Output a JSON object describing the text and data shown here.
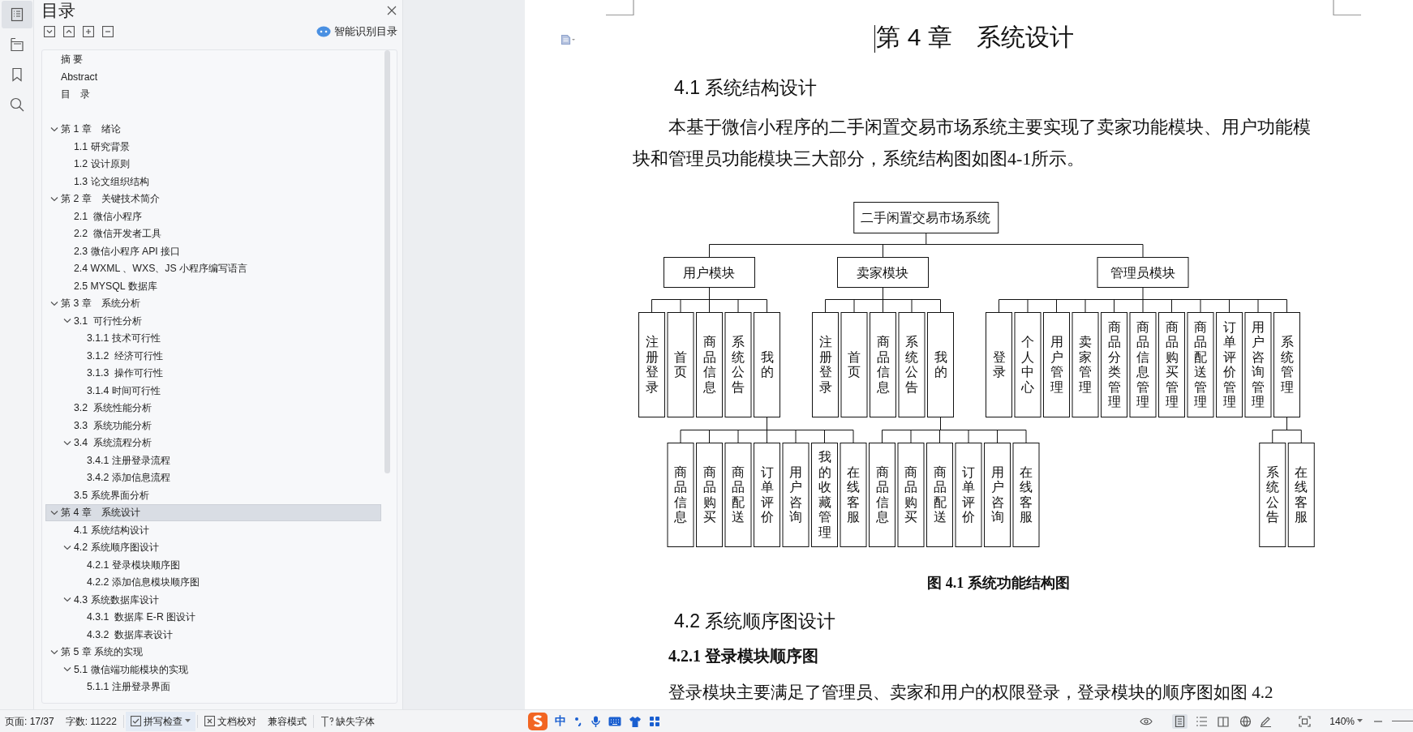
{
  "sidebar_rail": [
    {
      "kind": "contents",
      "selected": true
    },
    {
      "kind": "outline",
      "selected": false
    },
    {
      "kind": "bookmark",
      "selected": false
    },
    {
      "kind": "search",
      "selected": false
    }
  ],
  "toc_panel": {
    "title": "目录",
    "tools": [
      {
        "kind": "collapse"
      },
      {
        "kind": "expand"
      },
      {
        "kind": "promote"
      },
      {
        "kind": "demote"
      }
    ],
    "smart_button": "智能识别目录",
    "front_matter": [
      {
        "label": "摘 要"
      },
      {
        "label": "Abstract"
      },
      {
        "label": "目　录"
      }
    ],
    "chapters": [
      {
        "label": "第 1 章　绪论",
        "expanded": true,
        "selected": false,
        "children": [
          {
            "label": "1.1 研究背景"
          },
          {
            "label": "1.2 设计原则"
          },
          {
            "label": "1.3 论文组织结构"
          }
        ]
      },
      {
        "label": "第 2 章　关键技术简介",
        "expanded": true,
        "selected": false,
        "children": [
          {
            "label": "2.1  微信小程序"
          },
          {
            "label": "2.2  微信开发者工具"
          },
          {
            "label": "2.3 微信小程序 API 接口"
          },
          {
            "label": "2.4 WXML 、WXS、JS 小程序编写语言"
          },
          {
            "label": "2.5 MYSQL 数据库"
          }
        ]
      },
      {
        "label": "第 3 章　系统分析",
        "expanded": true,
        "selected": false,
        "children": [
          {
            "label": "3.1  可行性分析",
            "expanded": true,
            "children": [
              {
                "label": "3.1.1 技术可行性"
              },
              {
                "label": "3.1.2  经济可行性"
              },
              {
                "label": "3.1.3  操作可行性"
              },
              {
                "label": "3.1.4 时间可行性"
              }
            ]
          },
          {
            "label": "3.2  系统性能分析"
          },
          {
            "label": "3.3  系统功能分析"
          },
          {
            "label": "3.4  系统流程分析",
            "expanded": true,
            "children": [
              {
                "label": "3.4.1 注册登录流程"
              },
              {
                "label": "3.4.2 添加信息流程"
              }
            ]
          },
          {
            "label": "3.5 系统界面分析"
          }
        ]
      },
      {
        "label": "第 4 章　系统设计",
        "expanded": true,
        "selected": true,
        "children": [
          {
            "label": "4.1 系统结构设计"
          },
          {
            "label": "4.2 系统顺序图设计",
            "expanded": true,
            "children": [
              {
                "label": "4.2.1 登录模块顺序图"
              },
              {
                "label": "4.2.2 添加信息模块顺序图"
              }
            ]
          },
          {
            "label": "4.3 系统数据库设计",
            "expanded": true,
            "children": [
              {
                "label": "4.3.1  数据库 E-R 图设计"
              },
              {
                "label": "4.3.2  数据库表设计"
              }
            ]
          }
        ]
      },
      {
        "label": "第 5 章 系统的实现",
        "expanded": true,
        "selected": false,
        "children": [
          {
            "label": "5.1 微信端功能模块的实现",
            "expanded": true,
            "children": [
              {
                "label": "5.1.1 注册登录界面"
              }
            ]
          }
        ]
      }
    ]
  },
  "document": {
    "chapter_title": "第 4 章　系统设计",
    "section_1": "4.1 系统结构设计",
    "paragraph_1": "本基于微信小程序的二手闲置交易市场系统主要实现了卖家功能模块、用户功能模块和管理员功能模块三大部分，系统结构图如图4-1所示。",
    "diagram": {
      "label": "二手闲置交易市场系统",
      "children": [
        {
          "label": "用户模块",
          "children": [
            {
              "label": "注册登录"
            },
            {
              "label": "首页"
            },
            {
              "label": "商品信息"
            },
            {
              "label": "系统公告"
            },
            {
              "label": "我的",
              "children": [
                {
                  "label": "商品信息"
                },
                {
                  "label": "商品购买"
                },
                {
                  "label": "商品配送"
                },
                {
                  "label": "订单评价"
                },
                {
                  "label": "用户咨询"
                },
                {
                  "label": "我的收藏管理"
                },
                {
                  "label": "在线客服"
                }
              ]
            }
          ]
        },
        {
          "label": "卖家模块",
          "children": [
            {
              "label": "注册登录"
            },
            {
              "label": "首页"
            },
            {
              "label": "商品信息"
            },
            {
              "label": "系统公告"
            },
            {
              "label": "我的",
              "children": [
                {
                  "label": "商品信息"
                },
                {
                  "label": "商品购买"
                },
                {
                  "label": "商品配送"
                },
                {
                  "label": "订单评价"
                },
                {
                  "label": "用户咨询"
                },
                {
                  "label": "在线客服"
                }
              ]
            }
          ]
        },
        {
          "label": "管理员模块",
          "children": [
            {
              "label": "登录"
            },
            {
              "label": "个人中心"
            },
            {
              "label": "用户管理"
            },
            {
              "label": "卖家管理"
            },
            {
              "label": "商品分类管理"
            },
            {
              "label": "商品信息管理"
            },
            {
              "label": "商品购买管理"
            },
            {
              "label": "商品配送管理"
            },
            {
              "label": "订单评价管理"
            },
            {
              "label": "用户咨询管理"
            },
            {
              "label": "系统管理",
              "children": [
                {
                  "label": "系统公告"
                },
                {
                  "label": "在线客服"
                }
              ]
            }
          ]
        }
      ]
    },
    "caption": "图 4.1 系统功能结构图",
    "section_2": "4.2 系统顺序图设计",
    "subsection": "4.2.1 登录模块顺序图",
    "paragraph_2": "登录模块主要满足了管理员、卖家和用户的权限登录，登录模块的顺序图如图 4.2"
  },
  "status_bar": {
    "left": [
      {
        "kind": "text",
        "text": "页面: 17/37"
      },
      {
        "kind": "text",
        "text": "字数: 11222"
      },
      {
        "kind": "spellcheck",
        "text": "拼写检查",
        "checked": true
      },
      {
        "kind": "proofread",
        "text": "文档校对"
      },
      {
        "kind": "text",
        "text": "兼容模式"
      },
      {
        "kind": "missing_font",
        "text": "缺失字体"
      }
    ],
    "ime": [
      {
        "kind": "logo"
      },
      {
        "kind": "text",
        "text": "中"
      },
      {
        "kind": "punctuation"
      },
      {
        "kind": "mic"
      },
      {
        "kind": "keyboard"
      },
      {
        "kind": "skin"
      },
      {
        "kind": "toolbox"
      }
    ],
    "right": [
      {
        "kind": "eye"
      },
      {
        "kind": "view_page",
        "selected": true
      },
      {
        "kind": "view_outline",
        "selected": false
      },
      {
        "kind": "view_read",
        "selected": false
      },
      {
        "kind": "view_web",
        "selected": false
      },
      {
        "kind": "pen"
      },
      {
        "kind": "fit"
      },
      {
        "kind": "zoom",
        "text": "140%"
      },
      {
        "kind": "zoom_out"
      },
      {
        "kind": "zoom_track"
      }
    ]
  }
}
